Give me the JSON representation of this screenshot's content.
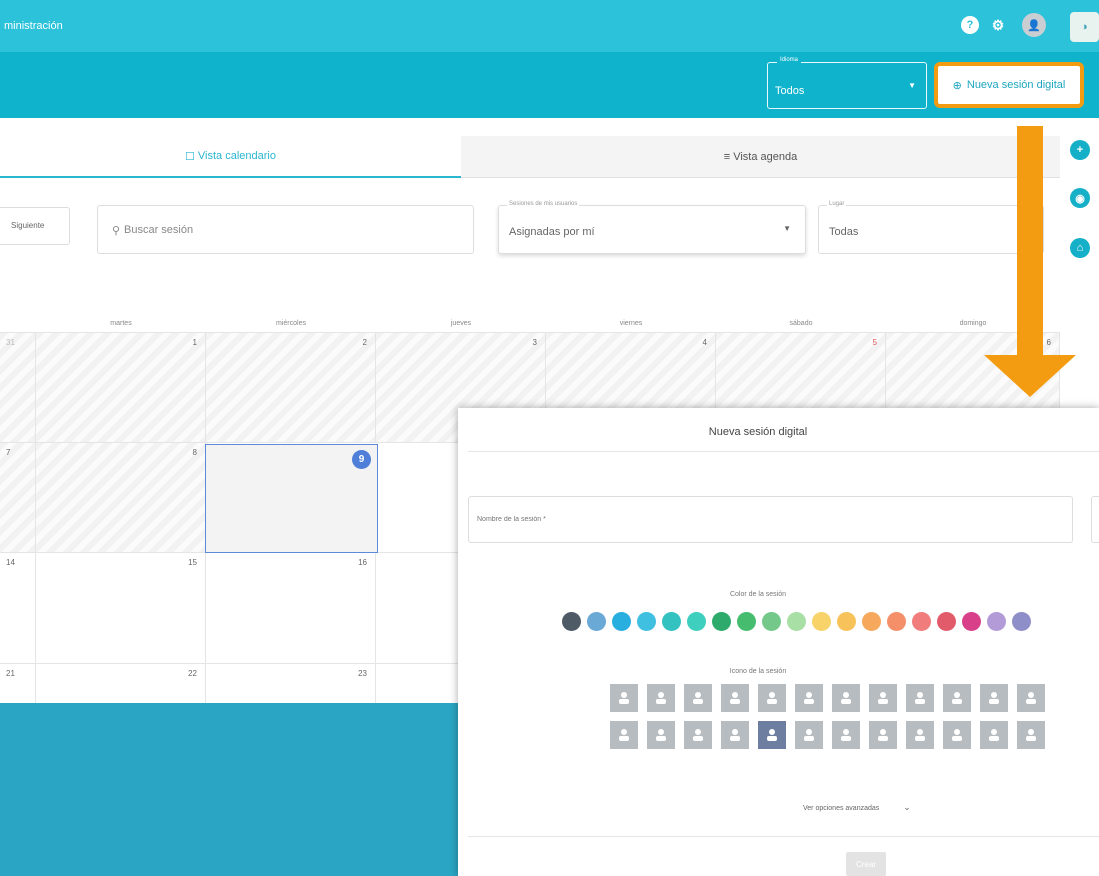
{
  "app": {
    "title": "ministración"
  },
  "topbar_icons": [
    {
      "name": "help-icon",
      "glyph": "?"
    },
    {
      "name": "settings-icon",
      "glyph": "⚙"
    },
    {
      "name": "user-avatar-icon",
      "glyph": "●"
    }
  ],
  "language": {
    "label": "Idioma",
    "value": "Todos"
  },
  "new_session_button": {
    "label": "Nueva sesión digital"
  },
  "tabs": [
    {
      "label": "Vista calendario",
      "active": true
    },
    {
      "label": "Vista agenda",
      "active": false
    }
  ],
  "toolbar": {
    "next_label": "Siguiente",
    "search_placeholder": "Buscar sesión",
    "sessions_filter": {
      "label": "Sesiones de mis usuarios",
      "value": "Asignadas por mí"
    },
    "place_filter": {
      "label": "Lugar",
      "value": "Todas"
    }
  },
  "calendar": {
    "weekdays": [
      "martes",
      "miércoles",
      "jueves",
      "viernes",
      "sábado",
      "domingo"
    ],
    "rows": [
      [
        "31",
        "1",
        "2",
        "3",
        "4",
        "5",
        "6"
      ],
      [
        "7",
        "8",
        "9",
        "",
        "",
        "",
        ""
      ],
      [
        "14",
        "15",
        "16",
        "",
        "",
        "",
        ""
      ],
      [
        "21",
        "22",
        "23",
        "",
        "",
        "",
        ""
      ]
    ],
    "today": "9"
  },
  "modal": {
    "title": "Nueva sesión digital",
    "name_placeholder": "Nombre de la sesión *",
    "color_caption": "Color de la sesión",
    "colors": [
      "#4f5a67",
      "#6aa8d6",
      "#29aee0",
      "#3fc0e0",
      "#33c2c0",
      "#3fcfbf",
      "#2eab6c",
      "#46bd6e",
      "#74c98a",
      "#a7dfa5",
      "#f7d36a",
      "#f8c25a",
      "#f6a85c",
      "#f58f6a",
      "#f07c7c",
      "#e25b6a",
      "#d8408a",
      "#b39bd8",
      "#8e8ec8"
    ],
    "icon_caption": "Icono de la sesión",
    "icons_row1": [
      "person-icon",
      "head-idea-icon",
      "speech-icon",
      "hand-wave-icon",
      "brain-icon",
      "brain-side-icon",
      "head-thought-icon",
      "hand-touch-icon",
      "building-icon",
      "heart-icon",
      "presentation-icon",
      "more-icon"
    ],
    "icons_row2": [
      "ear-icon",
      "head-bubble-icon",
      "mask-icon",
      "alert-icon",
      "walking-icon",
      "bed-icon",
      "cutlery-icon",
      "group-icon",
      "gift-icon",
      "chat-icon",
      "head-gear-icon",
      "more-icon"
    ],
    "advanced_label": "Ver opciones avanzadas",
    "create_label": "Crear"
  }
}
